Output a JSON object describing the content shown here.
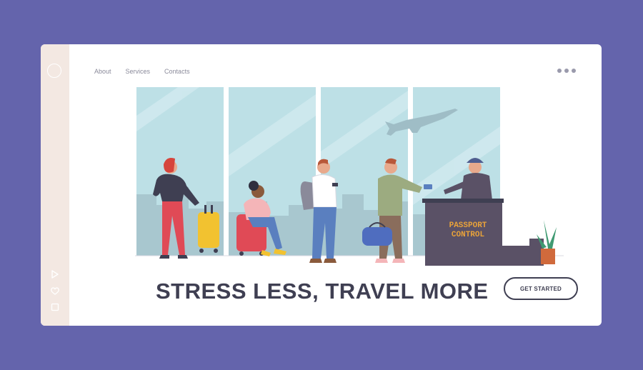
{
  "nav": {
    "items": [
      {
        "label": "About"
      },
      {
        "label": "Services"
      },
      {
        "label": "Contacts"
      }
    ]
  },
  "hero": {
    "desk_sign_line1": "PASSPORT",
    "desk_sign_line2": "CONTROL",
    "headline": "STRESS LESS, TRAVEL MORE",
    "cta_label": "GET STARTED"
  },
  "colors": {
    "background": "#6464ac",
    "card": "#ffffff",
    "sidebar": "#f3e8e2",
    "window": "#bde0e6",
    "desk": "#5a5166",
    "desk_text": "#e8a23a",
    "headline": "#3f3f52"
  },
  "icons": [
    "circle-logo-icon",
    "play-icon",
    "heart-icon",
    "square-icon",
    "more-dots-icon"
  ]
}
